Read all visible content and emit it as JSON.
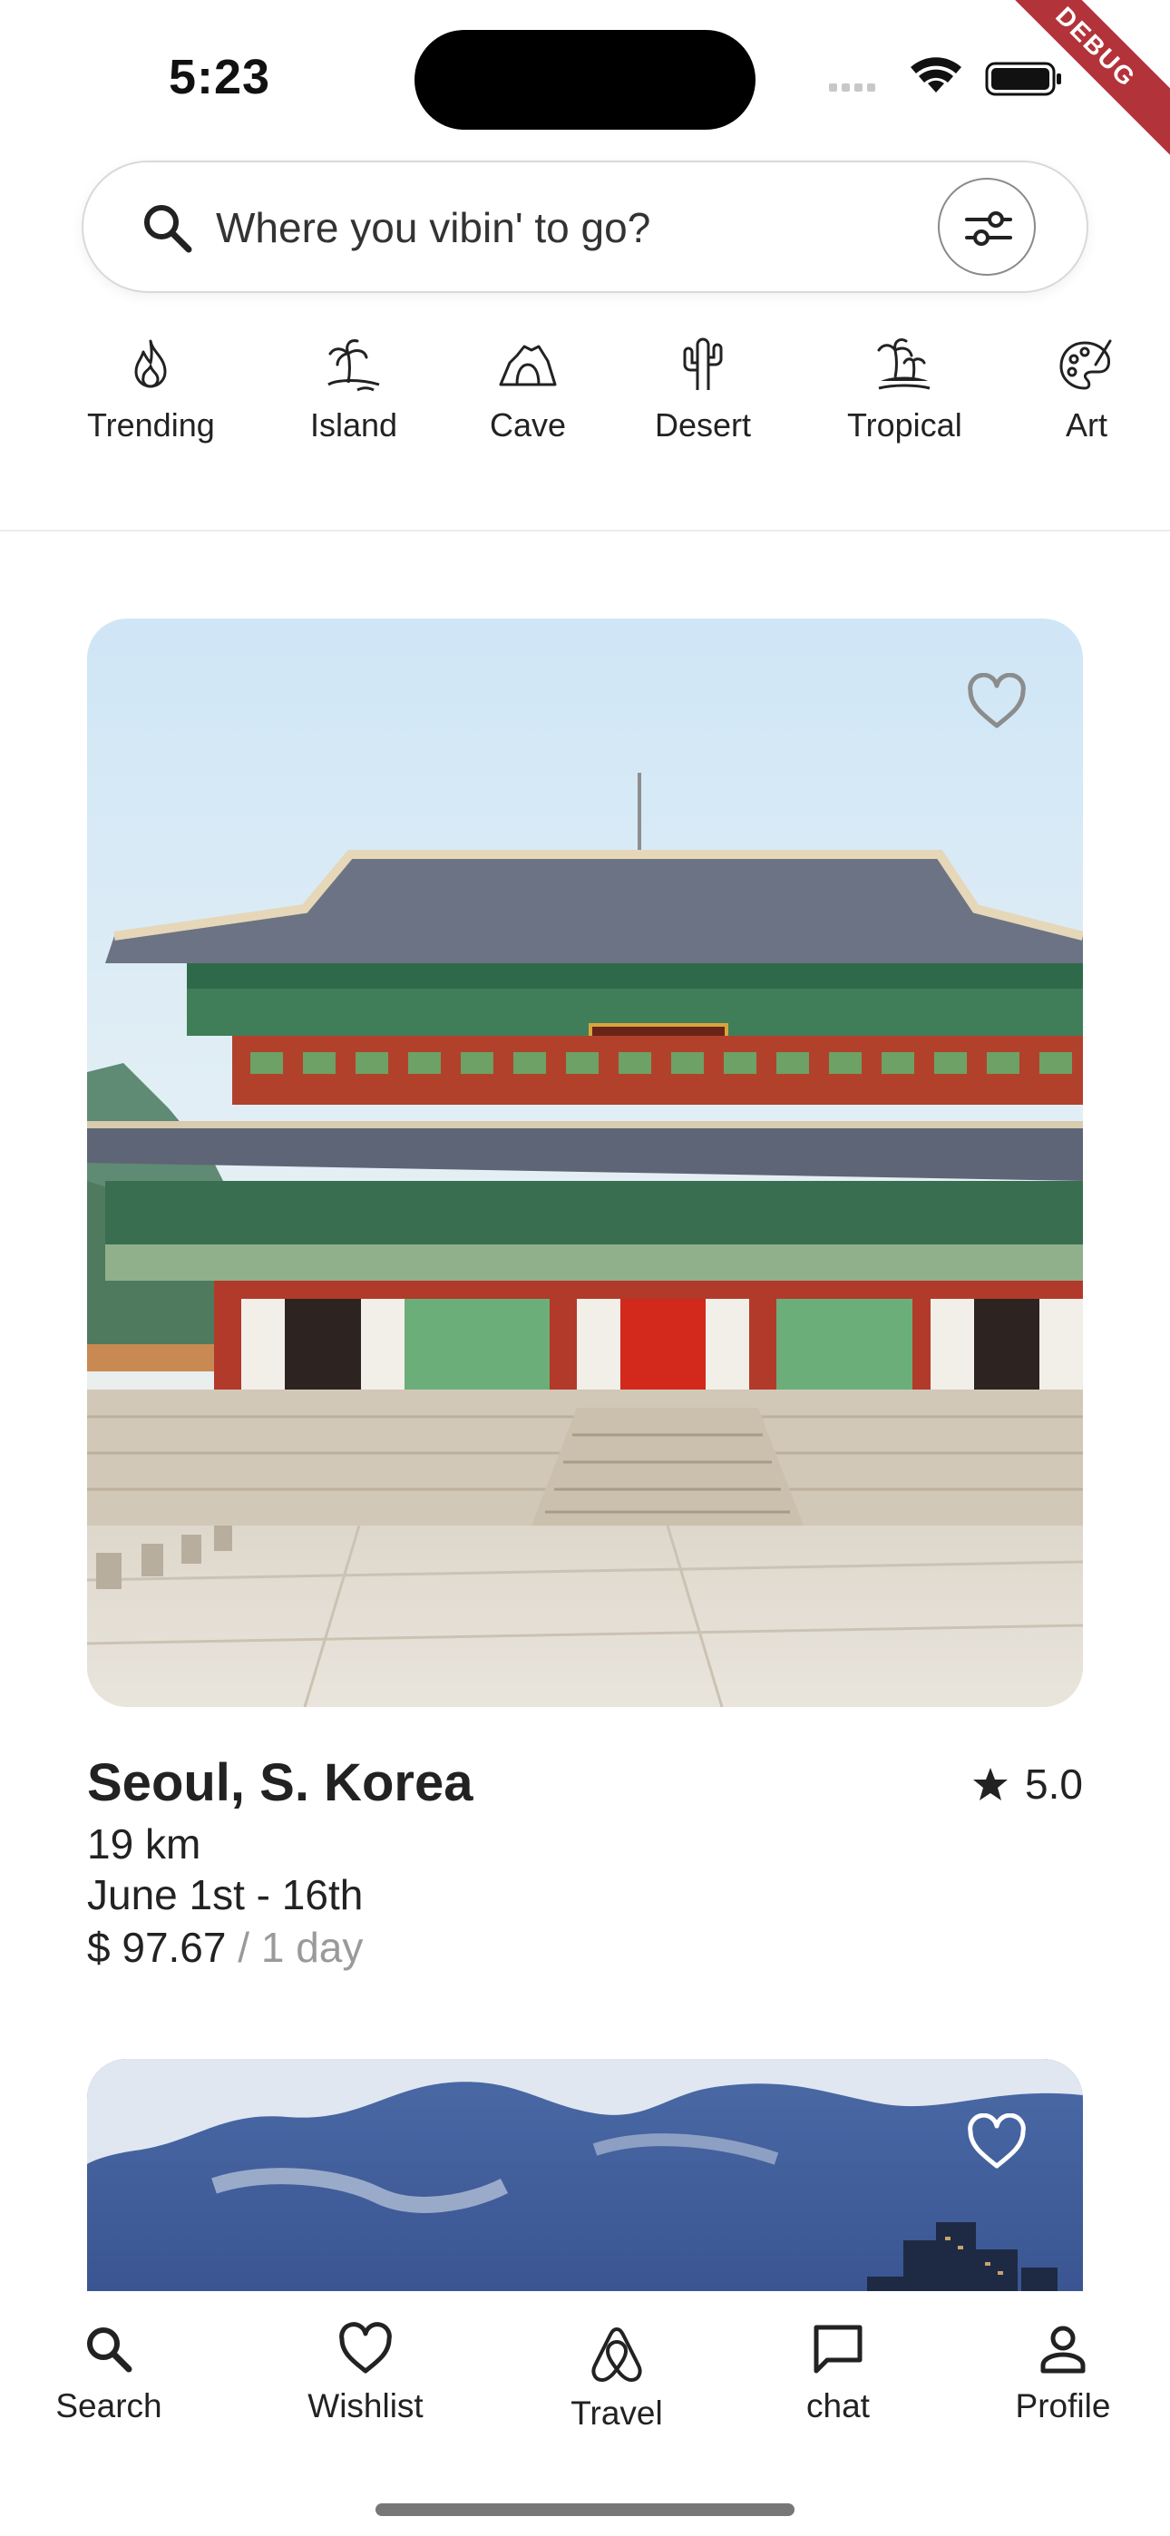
{
  "status_bar": {
    "time": "5:23",
    "debug_label": "DEBUG"
  },
  "search": {
    "placeholder": "Where you vibin' to go?",
    "icon": "search-icon",
    "filter_icon": "sliders-icon"
  },
  "categories": [
    {
      "label": "Trending",
      "icon": "flame-icon"
    },
    {
      "label": "Island",
      "icon": "palm-island-icon"
    },
    {
      "label": "Cave",
      "icon": "cave-icon"
    },
    {
      "label": "Desert",
      "icon": "cactus-icon"
    },
    {
      "label": "Tropical",
      "icon": "tropical-island-icon"
    },
    {
      "label": "Art",
      "icon": "palette-icon"
    }
  ],
  "listings": [
    {
      "title": "Seoul, S. Korea",
      "rating": "5.0",
      "distance": "19 km",
      "dates": "June 1st - 16th",
      "price": "$ 97.67",
      "price_unit": "/ 1 day",
      "image": "palace-photo",
      "wishlisted": false
    },
    {
      "image": "city-skyline-photo",
      "wishlisted": false
    }
  ],
  "bottom_nav": [
    {
      "label": "Search",
      "icon": "search-icon"
    },
    {
      "label": "Wishlist",
      "icon": "heart-icon"
    },
    {
      "label": "Travel",
      "icon": "airbnb-logo-icon"
    },
    {
      "label": "chat",
      "icon": "chat-bubble-icon"
    },
    {
      "label": "Profile",
      "icon": "person-icon"
    }
  ],
  "colors": {
    "debug_banner": "#b3333a",
    "text_primary": "#222222",
    "text_muted": "#9a9a9a",
    "border": "#d9d9d9"
  }
}
